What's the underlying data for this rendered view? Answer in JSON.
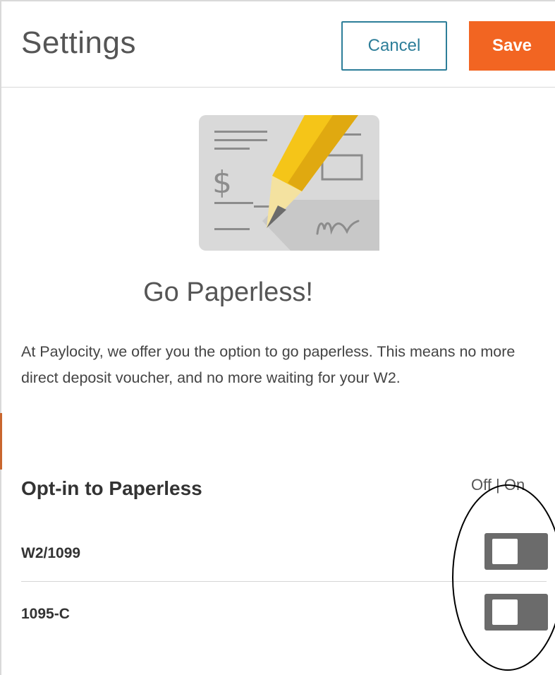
{
  "header": {
    "title": "Settings",
    "cancel_label": "Cancel",
    "save_label": "Save"
  },
  "main": {
    "illustration_icon": "paperless-check-pencil-icon",
    "headline": "Go Paperless!",
    "description": "At Paylocity, we offer you the option to go paperless. This means no more direct deposit voucher, and no more waiting for your W2.",
    "section_title": "Opt-in to Paperless",
    "toggle_legend": "Off | On",
    "options": [
      {
        "label": "W2/1099",
        "state": "Off"
      },
      {
        "label": "1095-C",
        "state": "Off"
      }
    ]
  },
  "colors": {
    "accent": "#2d7e99",
    "save": "#f26522",
    "toggle_off": "#6b6b6b"
  }
}
